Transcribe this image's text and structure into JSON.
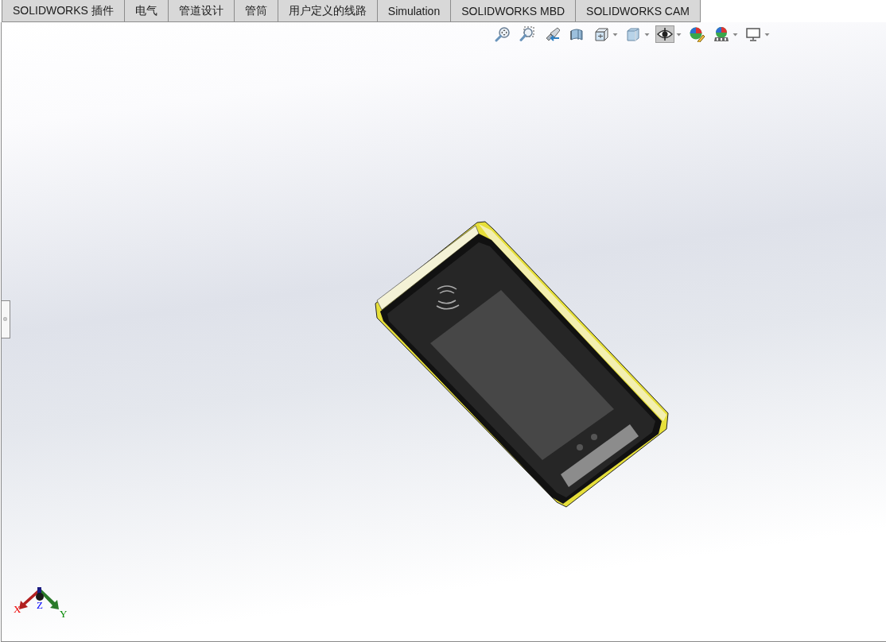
{
  "tabs": [
    {
      "label": "SOLIDWORKS 插件"
    },
    {
      "label": "电气"
    },
    {
      "label": "管道设计"
    },
    {
      "label": "管筒"
    },
    {
      "label": "用户定义的线路"
    },
    {
      "label": "Simulation"
    },
    {
      "label": "SOLIDWORKS MBD"
    },
    {
      "label": "SOLIDWORKS CAM"
    }
  ],
  "view_toolbar": [
    {
      "kind": "zoom-fit",
      "pressed": false,
      "dropdown": false
    },
    {
      "kind": "zoom-area",
      "pressed": false,
      "dropdown": false
    },
    {
      "kind": "previous-view",
      "pressed": false,
      "dropdown": false
    },
    {
      "kind": "section-view",
      "pressed": false,
      "dropdown": false
    },
    {
      "kind": "view-orientation",
      "pressed": false,
      "dropdown": true
    },
    {
      "kind": "display-style",
      "pressed": false,
      "dropdown": true
    },
    {
      "kind": "hide-show",
      "pressed": true,
      "dropdown": true
    },
    {
      "kind": "edit-appearance",
      "pressed": false,
      "dropdown": false
    },
    {
      "kind": "apply-scene",
      "pressed": false,
      "dropdown": true
    },
    {
      "kind": "view-settings",
      "pressed": false,
      "dropdown": true
    }
  ],
  "triad": {
    "x_label": "X",
    "y_label": "Y",
    "z_label": "Z"
  }
}
